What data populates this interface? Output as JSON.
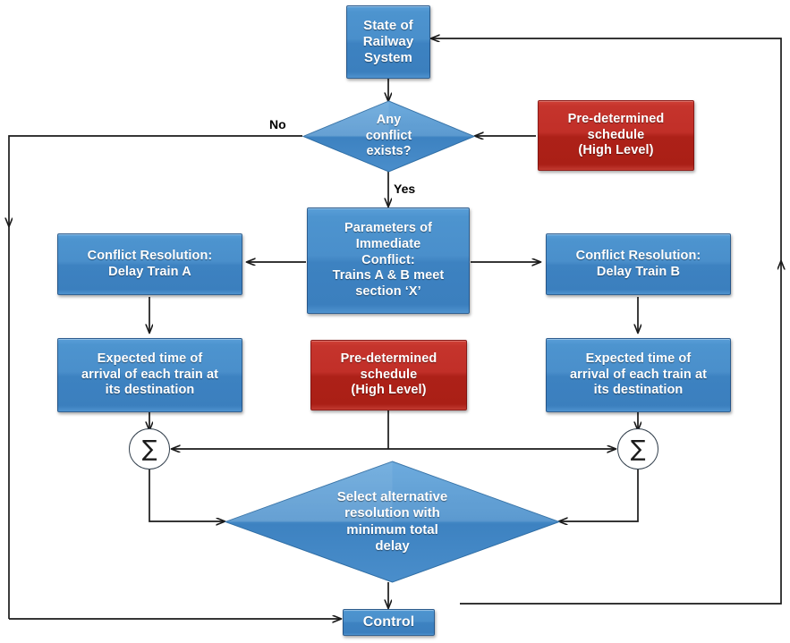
{
  "diagram": {
    "title": "Railway conflict resolution flowchart",
    "colors": {
      "process_blue": "#3d82c1",
      "data_red": "#bb2a20",
      "line": "#1a1a1a",
      "text_on_shape": "#ffffff",
      "edge_label": "#000000",
      "background": "#ffffff"
    },
    "nodes": {
      "state_of_railway_system": {
        "text": "State of\nRailway\nSystem",
        "shape": "rect",
        "color": "blue"
      },
      "any_conflict_exists": {
        "text": "Any\nconflict\nexists?",
        "shape": "diamond",
        "color": "blue"
      },
      "predetermined_schedule_top": {
        "text": "Pre-determined\nschedule\n(High Level)",
        "shape": "rect",
        "color": "red"
      },
      "parameters_of_immediate_conflict": {
        "text": "Parameters of\nImmediate\nConflict:\nTrains A & B meet\nsection ‘X’",
        "shape": "rect",
        "color": "blue"
      },
      "conflict_resolution_delay_train_a": {
        "text": "Conflict Resolution:\nDelay Train  A",
        "shape": "rect",
        "color": "blue"
      },
      "conflict_resolution_delay_train_b": {
        "text": "Conflict Resolution:\nDelay Train  B",
        "shape": "rect",
        "color": "blue"
      },
      "expected_time_left": {
        "text": "Expected time of\narrival of each train at\nits destination",
        "shape": "rect",
        "color": "blue"
      },
      "expected_time_right": {
        "text": "Expected time of\narrival of each train at\nits destination",
        "shape": "rect",
        "color": "blue"
      },
      "predetermined_schedule_middle": {
        "text": "Pre-determined\nschedule\n(High Level)",
        "shape": "rect",
        "color": "red"
      },
      "summation_left": {
        "text": "∑",
        "shape": "circle",
        "color": "white"
      },
      "summation_right": {
        "text": "∑",
        "shape": "circle",
        "color": "white"
      },
      "select_alternative_resolution": {
        "text": "Select alternative\nresolution with\nminimum total\ndelay",
        "shape": "diamond",
        "color": "blue"
      },
      "control": {
        "text": "Control",
        "shape": "rect",
        "color": "blue"
      }
    },
    "edge_labels": {
      "no": "No",
      "yes": "Yes"
    }
  }
}
